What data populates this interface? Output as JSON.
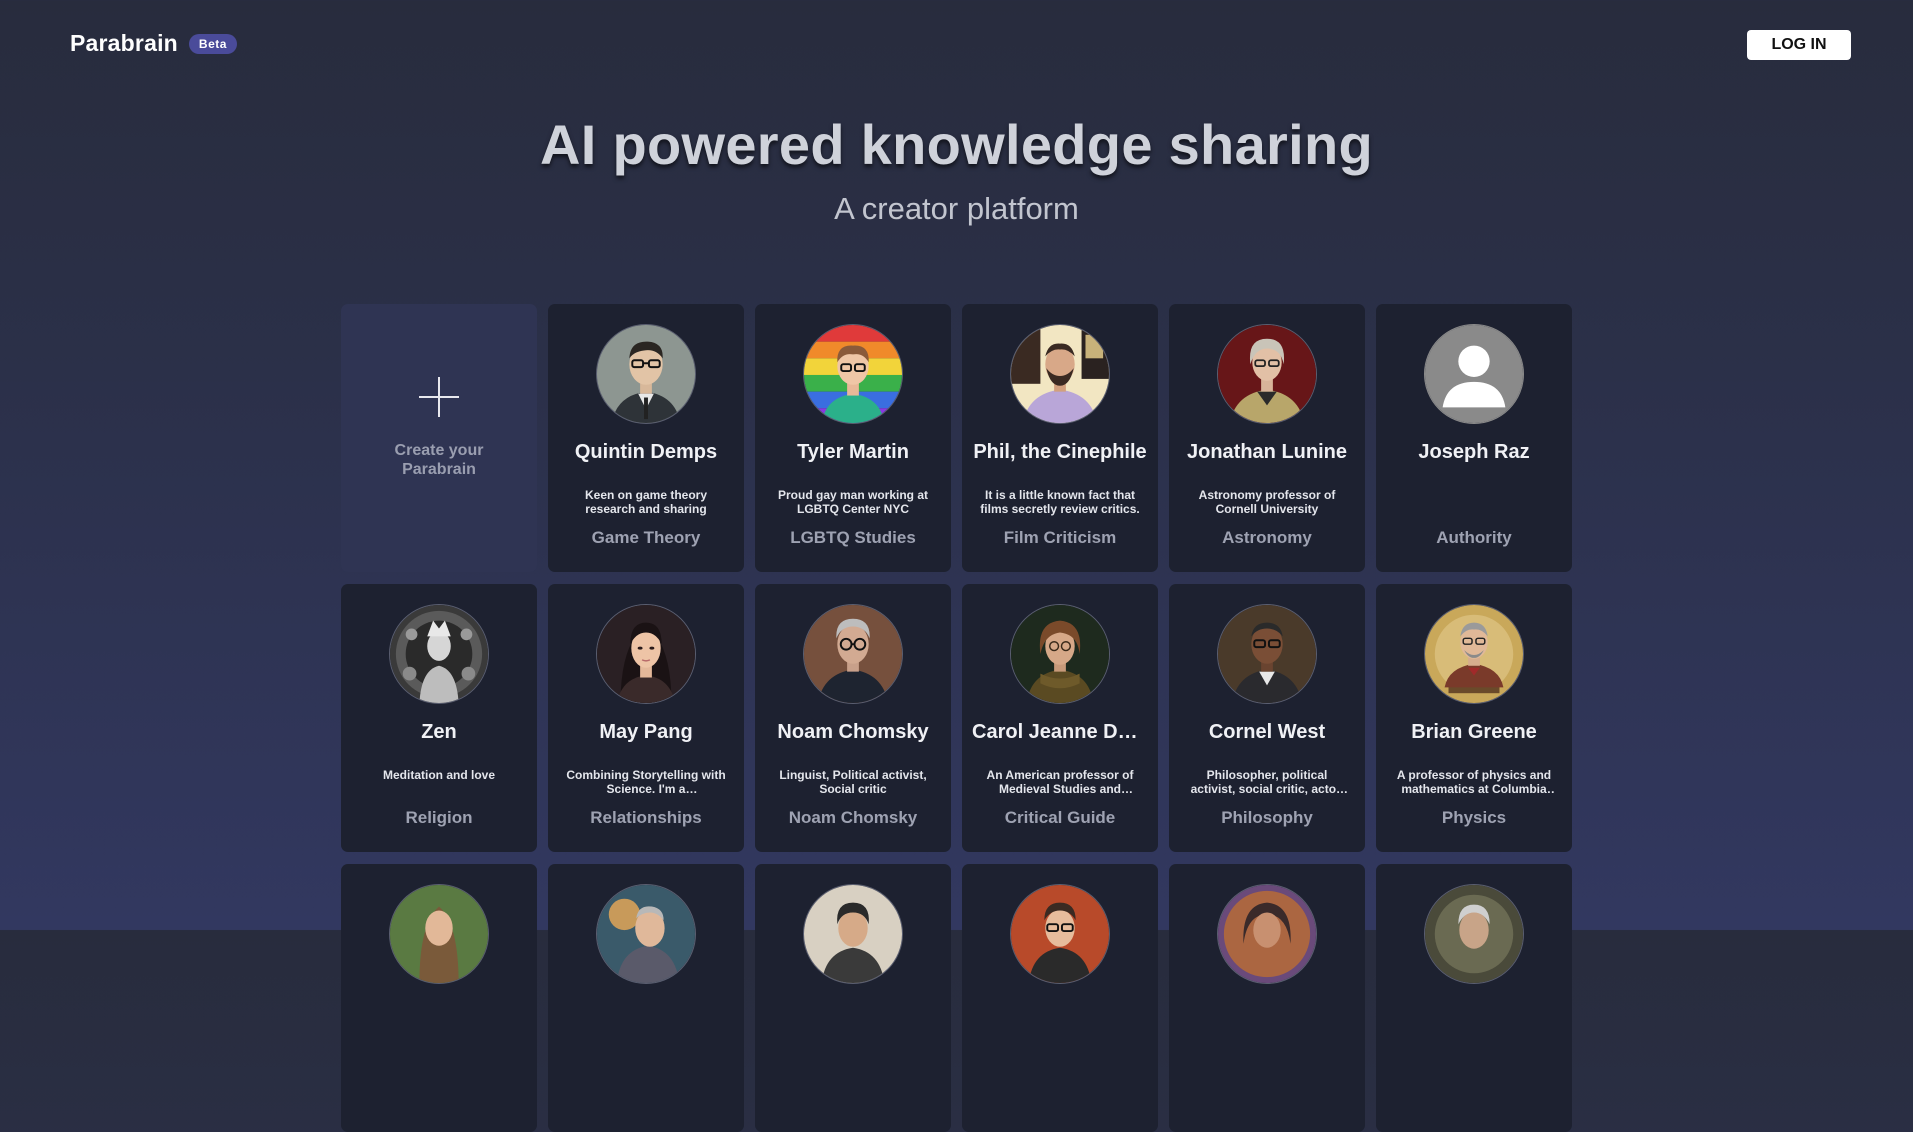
{
  "header": {
    "brand": "Parabrain",
    "badge": "Beta",
    "login_label": "LOG IN"
  },
  "hero": {
    "title": "AI powered knowledge sharing",
    "subtitle": "A creator platform"
  },
  "create_card": {
    "label": "Create your Parabrain",
    "icon": "plus-icon"
  },
  "cards": [
    {
      "name": "Quintin Demps",
      "desc": "Keen on game theory research and sharing",
      "category": "Game Theory"
    },
    {
      "name": "Tyler Martin",
      "desc": "Proud gay man working at LGBTQ Center NYC",
      "category": "LGBTQ Studies"
    },
    {
      "name": "Phil, the Cinephile",
      "desc": "It is a little known fact that films secretly review critics.",
      "category": "Film Criticism"
    },
    {
      "name": "Jonathan Lunine",
      "desc": "Astronomy professor of Cornell University",
      "category": "Astronomy"
    },
    {
      "name": "Joseph Raz",
      "desc": "",
      "category": "Authority"
    },
    {
      "name": "Zen",
      "desc": "Meditation and love",
      "category": "Religion"
    },
    {
      "name": "May Pang",
      "desc": "Combining Storytelling with Science. I'm a Communication specialist",
      "category": "Relationships"
    },
    {
      "name": "Noam Chomsky",
      "desc": "Linguist, Political activist, Social critic",
      "category": "Noam Chomsky"
    },
    {
      "name": "Carol Jeanne Dover",
      "desc": "An American professor of Medieval Studies and literature",
      "category": "Critical Guide"
    },
    {
      "name": "Cornel West",
      "desc": "Philosopher, political activist, social critic, actor, and public intellectual",
      "category": "Philosophy"
    },
    {
      "name": "Brian Greene",
      "desc": "A professor of physics and mathematics at Columbia University",
      "category": "Physics"
    },
    {
      "name": "",
      "desc": "",
      "category": ""
    },
    {
      "name": "",
      "desc": "",
      "category": ""
    },
    {
      "name": "",
      "desc": "",
      "category": ""
    },
    {
      "name": "",
      "desc": "",
      "category": ""
    },
    {
      "name": "",
      "desc": "",
      "category": ""
    },
    {
      "name": "",
      "desc": "",
      "category": ""
    }
  ],
  "colors": {
    "background_top": "#282c3d",
    "background_bottom": "#323860",
    "card": "#1d2130",
    "create_card": "#2f3453",
    "badge": "#4a4b9a"
  }
}
